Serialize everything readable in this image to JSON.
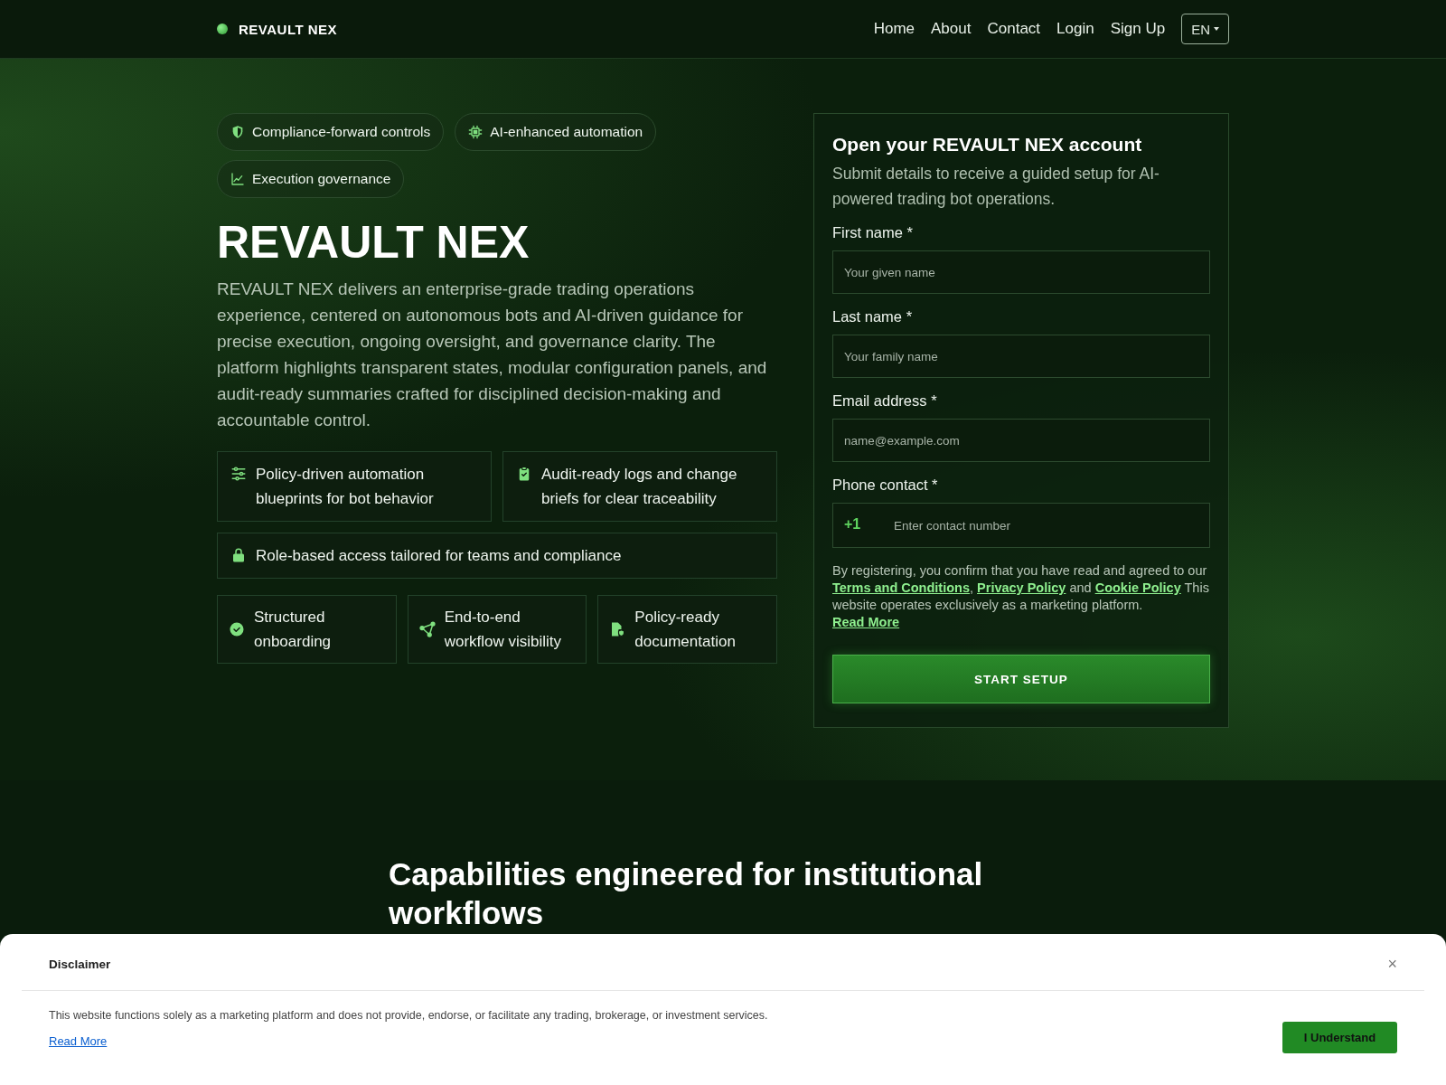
{
  "nav": {
    "brand": "REVAULT NEX",
    "links": [
      "Home",
      "About",
      "Contact",
      "Login",
      "Sign Up"
    ],
    "language": "EN"
  },
  "hero": {
    "badges": [
      "Compliance-forward controls",
      "AI-enhanced automation",
      "Execution governance"
    ],
    "title": "REVAULT NEX",
    "description": "REVAULT NEX delivers an enterprise-grade trading operations experience, centered on autonomous bots and AI-driven guidance for precise execution, ongoing oversight, and governance clarity. The platform highlights transparent states, modular configuration panels, and audit-ready summaries crafted for disciplined decision-making and accountable control.",
    "feature_rows": [
      [
        "Policy-driven automation blueprints for bot behavior",
        "Audit-ready logs and change briefs for clear traceability"
      ],
      [
        "Role-based access tailored for teams and compliance"
      ],
      [
        "Structured onboarding",
        "End-to-end workflow visibility",
        "Policy-ready documentation"
      ]
    ]
  },
  "form": {
    "title": "Open your REVAULT NEX account",
    "subtitle": "Submit details to receive a guided setup for AI-powered trading bot operations.",
    "fields": [
      {
        "kind": "text",
        "label": "First name *",
        "placeholder": "Your given name"
      },
      {
        "kind": "text",
        "label": "Last name *",
        "placeholder": "Your family name"
      },
      {
        "kind": "text",
        "label": "Email address *",
        "placeholder": "name@example.com"
      },
      {
        "kind": "phone",
        "label": "Phone contact *",
        "prefix": "+1",
        "placeholder": "Enter contact number"
      }
    ],
    "consent": [
      {
        "kind": "text",
        "text": "By registering, you confirm that you have read and agreed to our "
      },
      {
        "kind": "link",
        "text": "Terms and Conditions"
      },
      {
        "kind": "text",
        "text": ", "
      },
      {
        "kind": "link",
        "text": "Privacy Policy"
      },
      {
        "kind": "text",
        "text": " and "
      },
      {
        "kind": "link",
        "text": "Cookie Policy"
      },
      {
        "kind": "text",
        "text": " This website operates exclusively as a marketing platform. "
      },
      {
        "kind": "link",
        "text": "Read More"
      }
    ],
    "submit": "START SETUP"
  },
  "capabilities": {
    "heading": "Capabilities engineered for institutional workflows"
  },
  "disclaimer": {
    "title": "Disclaimer",
    "close": "×",
    "text": "This website functions solely as a marketing platform and does not provide, endorse, or facilitate any trading, brokerage, or investment services.",
    "link": "Read More",
    "button": "I Understand"
  }
}
